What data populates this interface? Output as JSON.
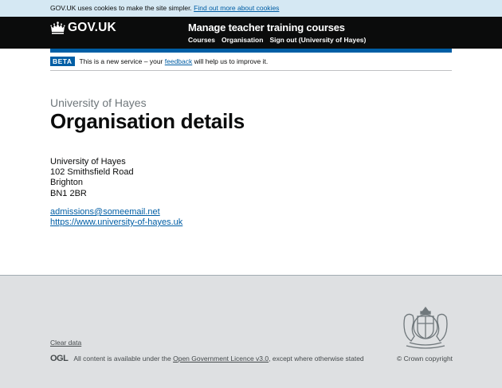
{
  "cookie_banner": {
    "text": "GOV.UK uses cookies to make the site simpler.",
    "link": "Find out more about cookies"
  },
  "header": {
    "logo_text": "GOV.UK",
    "service_name": "Manage teacher training courses",
    "nav": [
      {
        "label": "Courses"
      },
      {
        "label": "Organisation"
      },
      {
        "label": "Sign out (University of Hayes)"
      }
    ]
  },
  "phase_banner": {
    "tag": "BETA",
    "text_before": "This is a new service – your",
    "link": "feedback",
    "text_after": "will help us to improve it."
  },
  "main": {
    "caption": "University of Hayes",
    "title": "Organisation details",
    "address": [
      "University of Hayes",
      "102 Smithsfield Road",
      "Brighton",
      "BN1 2BR"
    ],
    "email": "admissions@someemail.net",
    "website": "https://www.university-of-hayes.uk"
  },
  "footer": {
    "clear_data": "Clear data",
    "ogl_logo": "OGL",
    "licence_before": "All content is available under the",
    "licence_link": "Open Government Licence v3.0",
    "licence_after": ", except where otherwise stated",
    "copyright": "© Crown copyright"
  },
  "colors": {
    "link": "#005ea5",
    "header_bg": "#0b0c0c",
    "cookie_bg": "#d5e8f3",
    "footer_bg": "#dee0e2"
  }
}
